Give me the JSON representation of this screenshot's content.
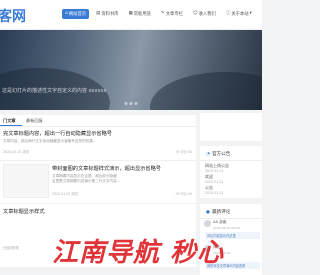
{
  "header": {
    "logo": "客网",
    "nav": [
      {
        "label": "网站首页",
        "icon": "home-icon",
        "glyph": "⌂",
        "active": true
      },
      {
        "label": "资料书库",
        "icon": "book-icon",
        "glyph": "▤",
        "active": false
      },
      {
        "label": "常板用途",
        "icon": "grid-icon",
        "glyph": "▦",
        "active": false
      },
      {
        "label": "文章专栏",
        "icon": "doc-icon",
        "glyph": "✎",
        "active": false
      },
      {
        "label": "收入我们",
        "icon": "user-icon",
        "glyph": "☺",
        "active": false
      },
      {
        "label": "关于本站",
        "icon": "info-icon",
        "glyph": "ⓘ",
        "active": false
      }
    ]
  },
  "banner": {
    "text": "这是幻灯片的描述性文字自定义的内容 xxxxxx"
  },
  "tabs": [
    "门文章",
    "最新回复"
  ],
  "posts": [
    {
      "title": "完文章标题内容，超出一行自动隐藏显示省略号",
      "excerpt": "文章内容，超出两行文字自动隐藏显示省略号这样的效果...",
      "meta": "2020-01-01  浏览",
      "stats": "99 评论  88"
    },
    {
      "title": "带封面图的文章标题样式演示，超出显示省略号",
      "excerpt_lines": [
        "文章摘要内容显示在这里，超出部分隐藏",
        "这里是文章摘要内容演示第二行文字内容..."
      ],
      "meta": "2020-01-01  浏览",
      "stats": "98 评论  66"
    },
    {
      "title": "文章标题显示样式",
      "excerpt": "",
      "meta": "",
      "stats": ""
    }
  ],
  "footer_hint": "已经到底啦",
  "sidebar": {
    "notice": {
      "title": "官方公告",
      "items": [
        {
          "title": "网站上线公告",
          "date": "2020-01-01"
        },
        {
          "title": "欢迎",
          "date": "2020-01-01"
        },
        {
          "title": "公告",
          "date": "2020-01-01"
        }
      ]
    },
    "comments": {
      "title": "最新评论",
      "items": [
        {
          "name": "AA 游客",
          "date": "2020-01-01 00:00",
          "text": "评论内容显示在这里"
        },
        {
          "name": "评论",
          "date": "2020-01-01",
          "text": "我的评论文章演示内容查看"
        }
      ]
    }
  },
  "watermark": "江南导航 秒心"
}
